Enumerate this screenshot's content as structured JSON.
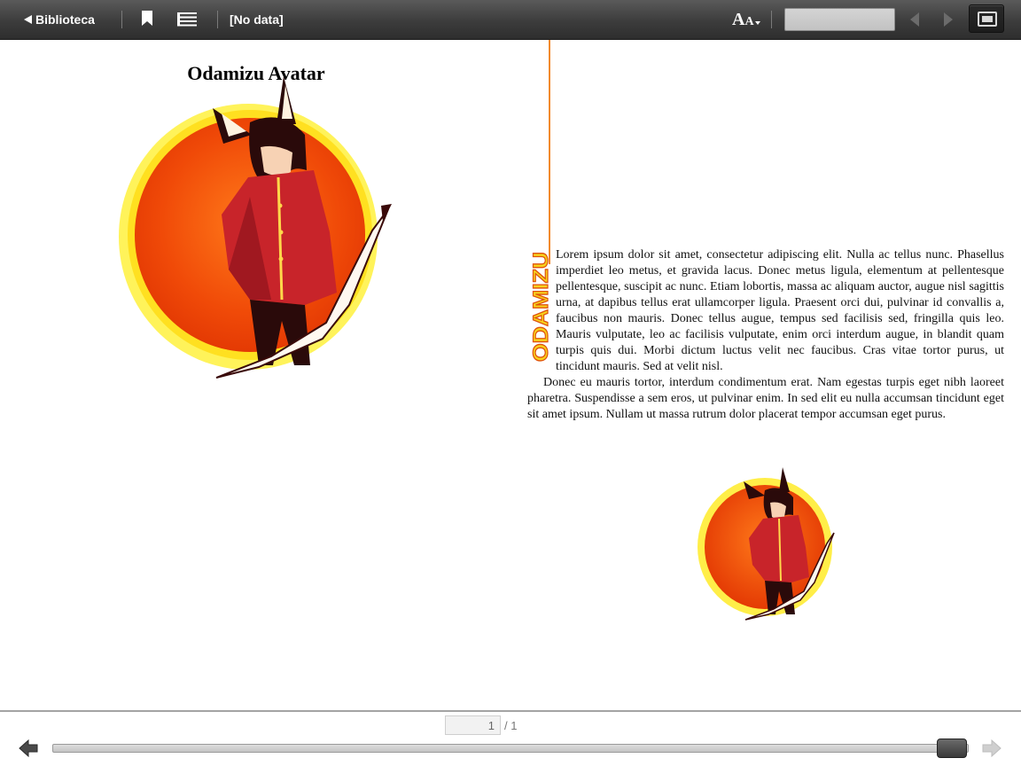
{
  "toolbar": {
    "back_label": "Biblioteca",
    "book_title": "[No data]",
    "search_value": "",
    "icons": [
      "back-triangle-icon",
      "bookmark-icon",
      "list-icon",
      "font-size-icon",
      "prev-arrow-icon",
      "next-arrow-icon",
      "fullscreen-icon"
    ],
    "font_glyph_big": "A",
    "font_glyph_small": "A"
  },
  "left_page": {
    "title": "Odamizu Avatar"
  },
  "right_page": {
    "dropcap_word": "ODAMIZU",
    "paragraph1": "Lorem ipsum dolor sit amet, consectetur adipiscing elit. Nulla ac tellus nunc. Phasellus imperdiet leo metus, et gravida lacus. Donec metus ligula, elementum at pellentesque pellentesque, suscipit ac nunc. Etiam lobortis, massa ac aliquam auctor, augue nisl sagittis urna, at dapibus tellus erat ullamcorper ligula. Praesent orci dui, pulvinar id convallis a, faucibus non mauris. Donec tellus augue, tempus sed facilisis sed, fringilla quis leo. Mauris vulputate, leo ac facilisis vulputate, enim orci interdum augue, in blandit quam turpis quis dui. Morbi dictum luctus velit nec faucibus. Cras vitae tortor purus, ut tincidunt mauris. Sed at velit nisl.",
    "paragraph2": "Donec eu mauris tortor, interdum condimentum erat. Nam egestas turpis eget nibh laoreet pharetra. Suspendisse a sem eros, ut pulvinar enim. In sed elit eu nulla accumsan tincidunt eget sit amet ipsum. Nullam ut massa rutrum dolor placerat tempor accumsan eget purus."
  },
  "pager": {
    "current_page": "1",
    "total_label": "/ 1",
    "progress": 1.0
  },
  "colors": {
    "accent_orange": "#f28a2d",
    "dropcap_fill": "#f7d21c",
    "dropcap_stroke": "#e0520a"
  }
}
